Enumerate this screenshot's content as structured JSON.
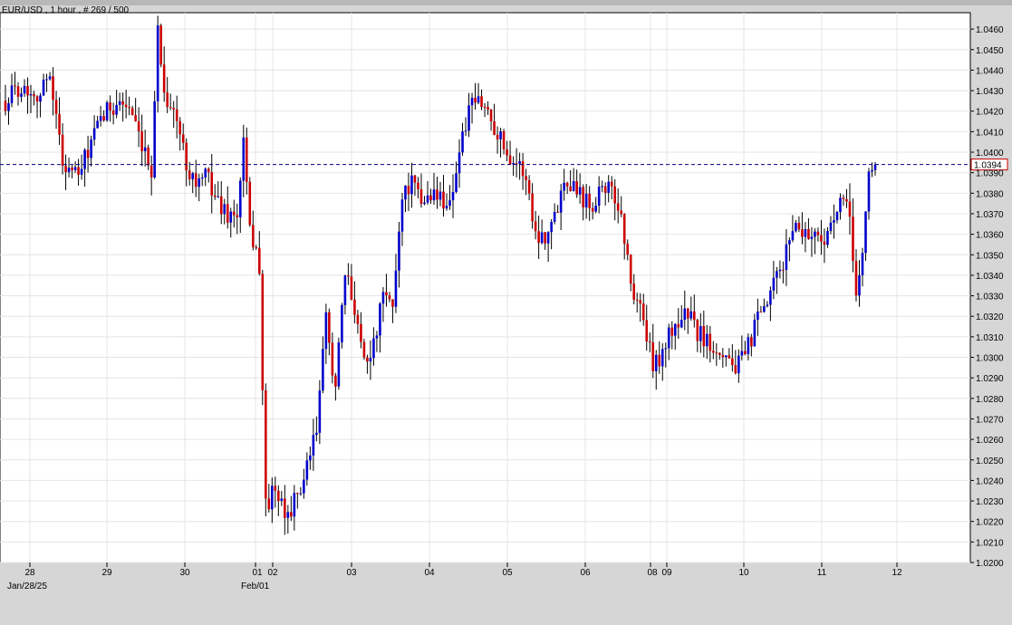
{
  "chart_data": {
    "type": "candlestick",
    "title": "EUR/USD , 1 hour , # 269 / 500",
    "current_price": "1.0394",
    "y_ticks": [
      "1.0460",
      "1.0450",
      "1.0440",
      "1.0430",
      "1.0420",
      "1.0410",
      "1.0400",
      "1.0390",
      "1.0380",
      "1.0370",
      "1.0360",
      "1.0350",
      "1.0340",
      "1.0330",
      "1.0320",
      "1.0310",
      "1.0300",
      "1.0290",
      "1.0280",
      "1.0270",
      "1.0260",
      "1.0250",
      "1.0240",
      "1.0230",
      "1.0220",
      "1.0210",
      "1.0200"
    ],
    "ylim": [
      1.02,
      1.0468
    ],
    "x_ticks": [
      {
        "label": "28",
        "sub": "Jan/28/25"
      },
      {
        "label": "29",
        "sub": ""
      },
      {
        "label": "30",
        "sub": ""
      },
      {
        "label": "01",
        "sub": "Feb/01"
      },
      {
        "label": "02",
        "sub": ""
      },
      {
        "label": "03",
        "sub": ""
      },
      {
        "label": "04",
        "sub": ""
      },
      {
        "label": "05",
        "sub": ""
      },
      {
        "label": "06",
        "sub": ""
      },
      {
        "label": "08",
        "sub": ""
      },
      {
        "label": "09",
        "sub": ""
      },
      {
        "label": "10",
        "sub": ""
      },
      {
        "label": "11",
        "sub": ""
      },
      {
        "label": "12",
        "sub": ""
      }
    ],
    "grid": true,
    "up_color": "#0000cc",
    "down_color": "#cc0000",
    "bg_color": "#ffffff",
    "price_line_color": "#000080",
    "anchors": [
      [
        0,
        1.0425
      ],
      [
        4,
        1.0432
      ],
      [
        8,
        1.043
      ],
      [
        11,
        1.0428
      ],
      [
        14,
        1.044
      ],
      [
        18,
        1.0395
      ],
      [
        23,
        1.0388
      ],
      [
        27,
        1.0405
      ],
      [
        31,
        1.0418
      ],
      [
        35,
        1.0425
      ],
      [
        39,
        1.0422
      ],
      [
        43,
        1.04
      ],
      [
        46,
        1.0392
      ],
      [
        48,
        1.046
      ],
      [
        50,
        1.043
      ],
      [
        54,
        1.0415
      ],
      [
        57,
        1.0395
      ],
      [
        60,
        1.0385
      ],
      [
        64,
        1.0388
      ],
      [
        67,
        1.0375
      ],
      [
        70,
        1.037
      ],
      [
        73,
        1.0368
      ],
      [
        75,
        1.0405
      ],
      [
        77,
        1.036
      ],
      [
        79,
        1.0355
      ],
      [
        80,
        1.034
      ],
      [
        82,
        1.0228
      ],
      [
        85,
        1.0235
      ],
      [
        88,
        1.0222
      ],
      [
        92,
        1.0232
      ],
      [
        95,
        1.0245
      ],
      [
        98,
        1.0265
      ],
      [
        101,
        1.0318
      ],
      [
        104,
        1.0285
      ],
      [
        107,
        1.034
      ],
      [
        110,
        1.0325
      ],
      [
        113,
        1.03
      ],
      [
        116,
        1.0305
      ],
      [
        119,
        1.033
      ],
      [
        122,
        1.0325
      ],
      [
        125,
        1.038
      ],
      [
        128,
        1.0385
      ],
      [
        131,
        1.0375
      ],
      [
        134,
        1.038
      ],
      [
        137,
        1.0378
      ],
      [
        140,
        1.0375
      ],
      [
        143,
        1.04
      ],
      [
        146,
        1.042
      ],
      [
        149,
        1.0425
      ],
      [
        152,
        1.042
      ],
      [
        155,
        1.041
      ],
      [
        158,
        1.04
      ],
      [
        161,
        1.0395
      ],
      [
        164,
        1.0388
      ],
      [
        167,
        1.036
      ],
      [
        170,
        1.036
      ],
      [
        173,
        1.0368
      ],
      [
        176,
        1.0388
      ],
      [
        179,
        1.0385
      ],
      [
        182,
        1.0378
      ],
      [
        185,
        1.0375
      ],
      [
        188,
        1.0385
      ],
      [
        191,
        1.038
      ],
      [
        194,
        1.037
      ],
      [
        197,
        1.0335
      ],
      [
        200,
        1.0325
      ],
      [
        202,
        1.031
      ],
      [
        204,
        1.0295
      ],
      [
        206,
        1.03
      ],
      [
        209,
        1.031
      ],
      [
        212,
        1.0318
      ],
      [
        215,
        1.0322
      ],
      [
        218,
        1.0312
      ],
      [
        221,
        1.0308
      ],
      [
        224,
        1.0305
      ],
      [
        227,
        1.0302
      ],
      [
        230,
        1.0295
      ],
      [
        233,
        1.03
      ],
      [
        236,
        1.0315
      ],
      [
        239,
        1.0322
      ],
      [
        242,
        1.0335
      ],
      [
        245,
        1.0345
      ],
      [
        248,
        1.0365
      ],
      [
        251,
        1.0362
      ],
      [
        254,
        1.036
      ],
      [
        257,
        1.0358
      ],
      [
        260,
        1.0362
      ],
      [
        263,
        1.0375
      ],
      [
        266,
        1.037
      ],
      [
        268,
        1.033
      ],
      [
        270,
        1.035
      ],
      [
        272,
        1.039
      ],
      [
        274,
        1.0394
      ]
    ]
  }
}
